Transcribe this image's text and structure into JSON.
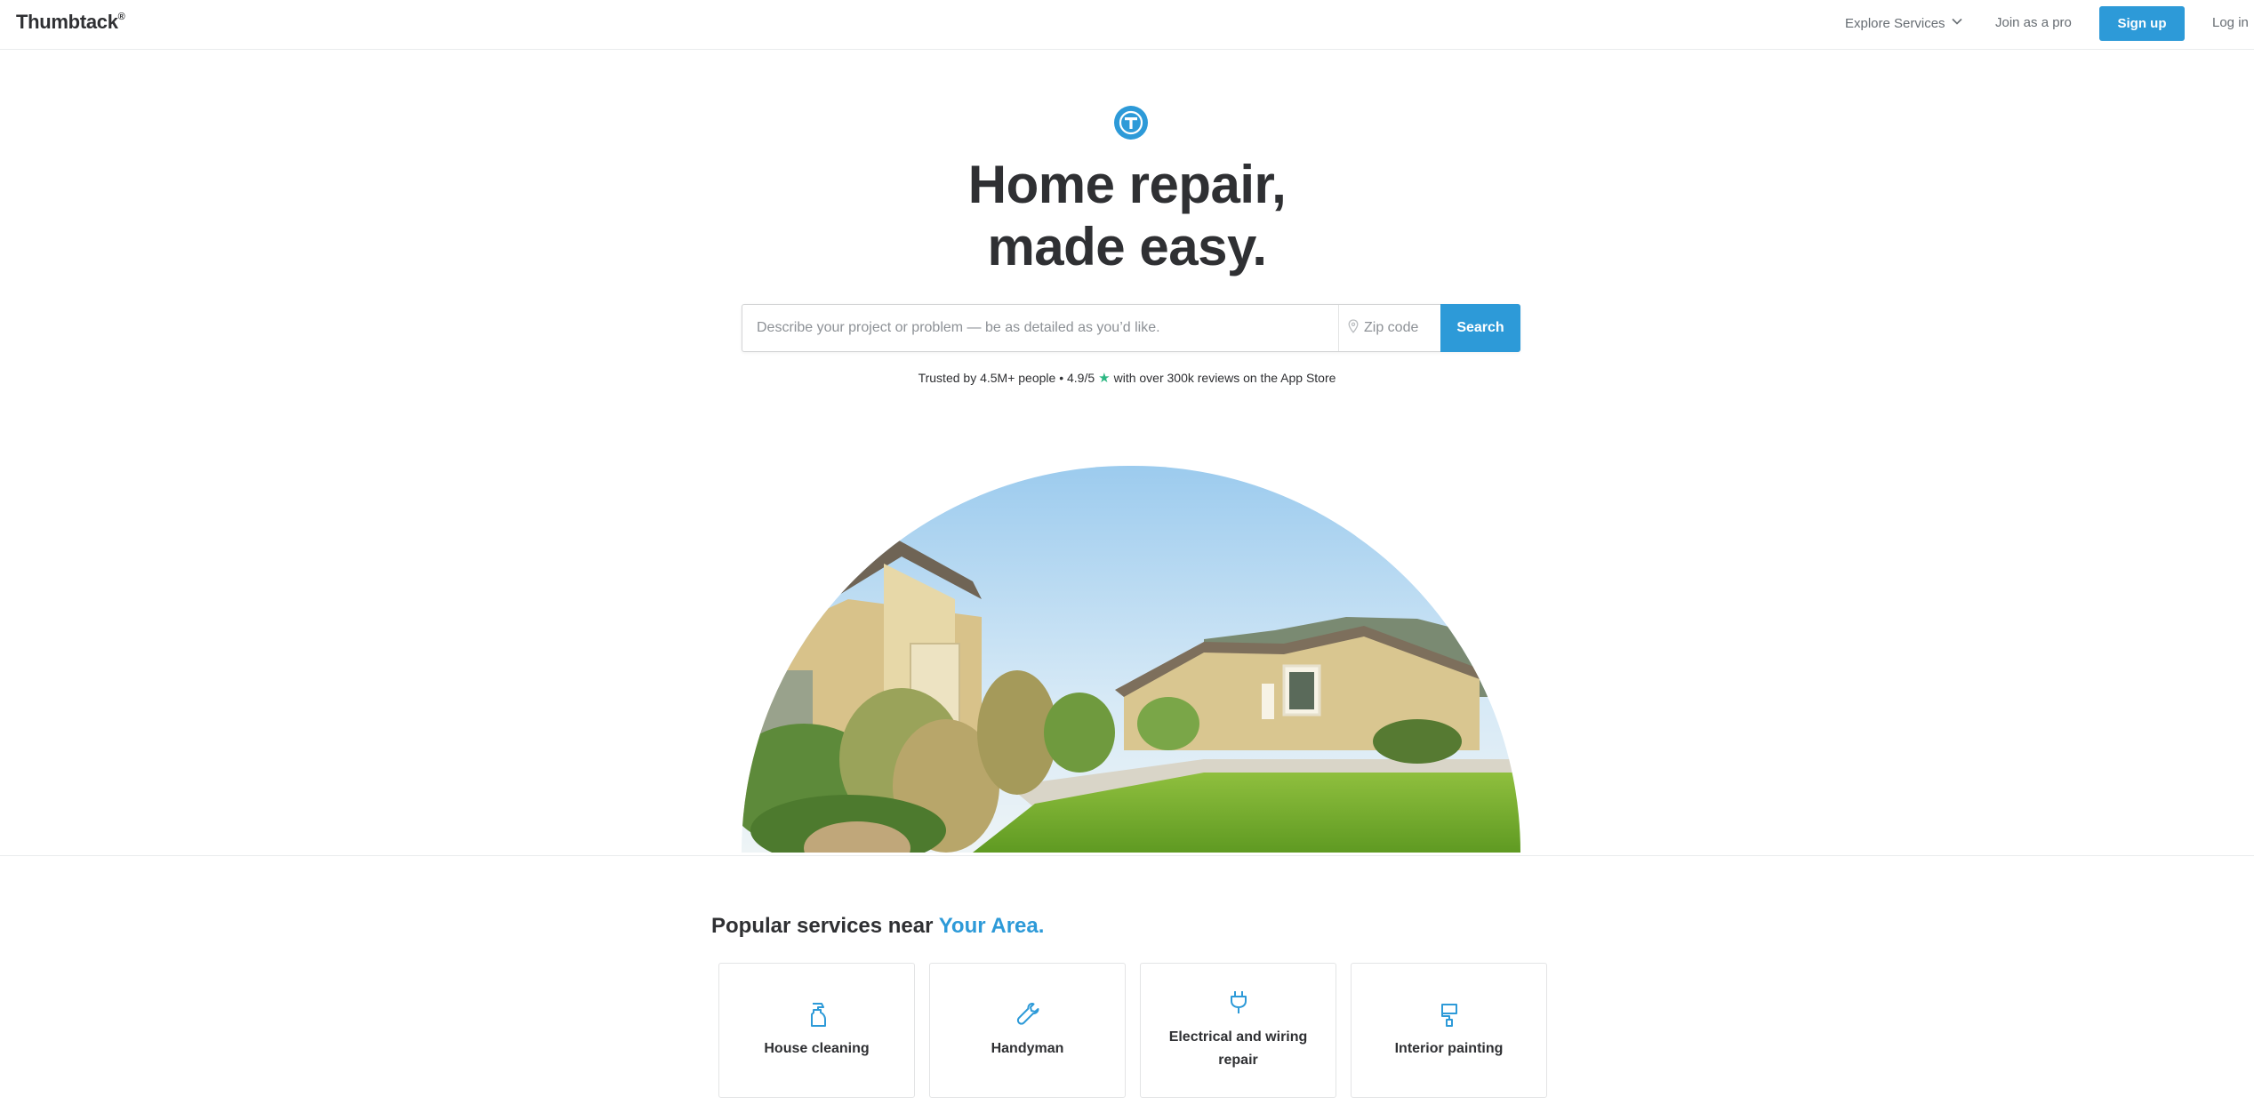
{
  "header": {
    "logo": "Thumbtack",
    "logo_mark": "®",
    "explore_label": "Explore Services",
    "join_label": "Join as a pro",
    "signup_label": "Sign up",
    "login_label": "Log in"
  },
  "hero": {
    "title_line1": "Home repair,",
    "title_line2": "made easy.",
    "search_placeholder": "Describe your project or problem — be as detailed as you’d like.",
    "zip_placeholder": "Zip code",
    "search_button": "Search",
    "trust_prefix": "Trusted by 4.5M+ people • 4.9/5",
    "trust_star": "★",
    "trust_suffix": "with over 300k reviews on the App Store"
  },
  "popular": {
    "title_prefix": "Popular services near",
    "title_accent": "Your Area.",
    "services": [
      {
        "label": "House cleaning",
        "icon": "spray-bottle-icon"
      },
      {
        "label": "Handyman",
        "icon": "wrench-icon"
      },
      {
        "label": "Electrical and wiring repair",
        "icon": "plug-icon"
      },
      {
        "label": "Interior painting",
        "icon": "paint-roller-icon"
      }
    ]
  },
  "colors": {
    "accent": "#2d9ad8",
    "star": "#2db783",
    "text": "#2f3033"
  }
}
